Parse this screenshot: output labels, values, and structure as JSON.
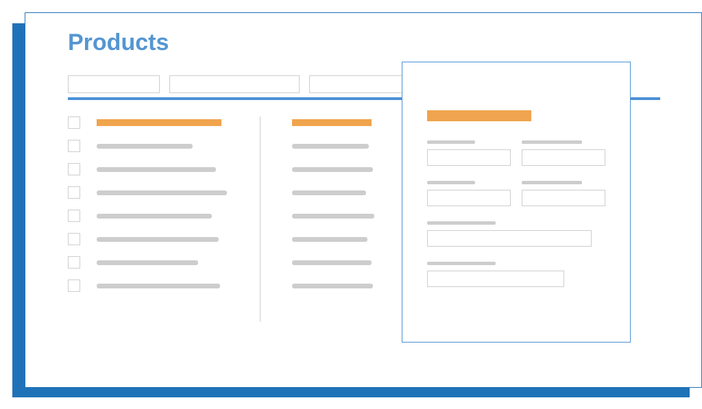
{
  "page": {
    "title": "Products"
  },
  "colors": {
    "frame": "#2072b8",
    "accent": "#f0a44d",
    "line": "#cdcdcd",
    "headerRule": "#4a90d6",
    "titleText": "#5596d1"
  },
  "filters": [
    {
      "id": "filter-1",
      "value": ""
    },
    {
      "id": "filter-2",
      "value": ""
    },
    {
      "id": "filter-3",
      "value": ""
    }
  ],
  "list": {
    "rows": [
      {
        "checked": false,
        "highlight": true,
        "widthPx": 182
      },
      {
        "checked": false,
        "highlight": false,
        "widthPx": 140
      },
      {
        "checked": false,
        "highlight": false,
        "widthPx": 174
      },
      {
        "checked": false,
        "highlight": false,
        "widthPx": 190
      },
      {
        "checked": false,
        "highlight": false,
        "widthPx": 168
      },
      {
        "checked": false,
        "highlight": false,
        "widthPx": 178
      },
      {
        "checked": false,
        "highlight": false,
        "widthPx": 148
      },
      {
        "checked": false,
        "highlight": false,
        "widthPx": 180
      }
    ]
  },
  "secondary": {
    "rows": [
      {
        "highlight": true,
        "widthPx": 116
      },
      {
        "highlight": false,
        "widthPx": 112
      },
      {
        "highlight": false,
        "widthPx": 118
      },
      {
        "highlight": false,
        "widthPx": 108
      },
      {
        "highlight": false,
        "widthPx": 120
      },
      {
        "highlight": false,
        "widthPx": 110
      },
      {
        "highlight": false,
        "widthPx": 116
      },
      {
        "highlight": false,
        "widthPx": 118
      }
    ]
  },
  "detail": {
    "fields_row1": [
      {
        "label": "",
        "value": ""
      },
      {
        "label": "",
        "value": ""
      }
    ],
    "fields_row2": [
      {
        "label": "",
        "value": ""
      },
      {
        "label": "",
        "value": ""
      }
    ],
    "field_full1": {
      "label": "",
      "value": ""
    },
    "field_full2": {
      "label": "",
      "value": ""
    }
  }
}
